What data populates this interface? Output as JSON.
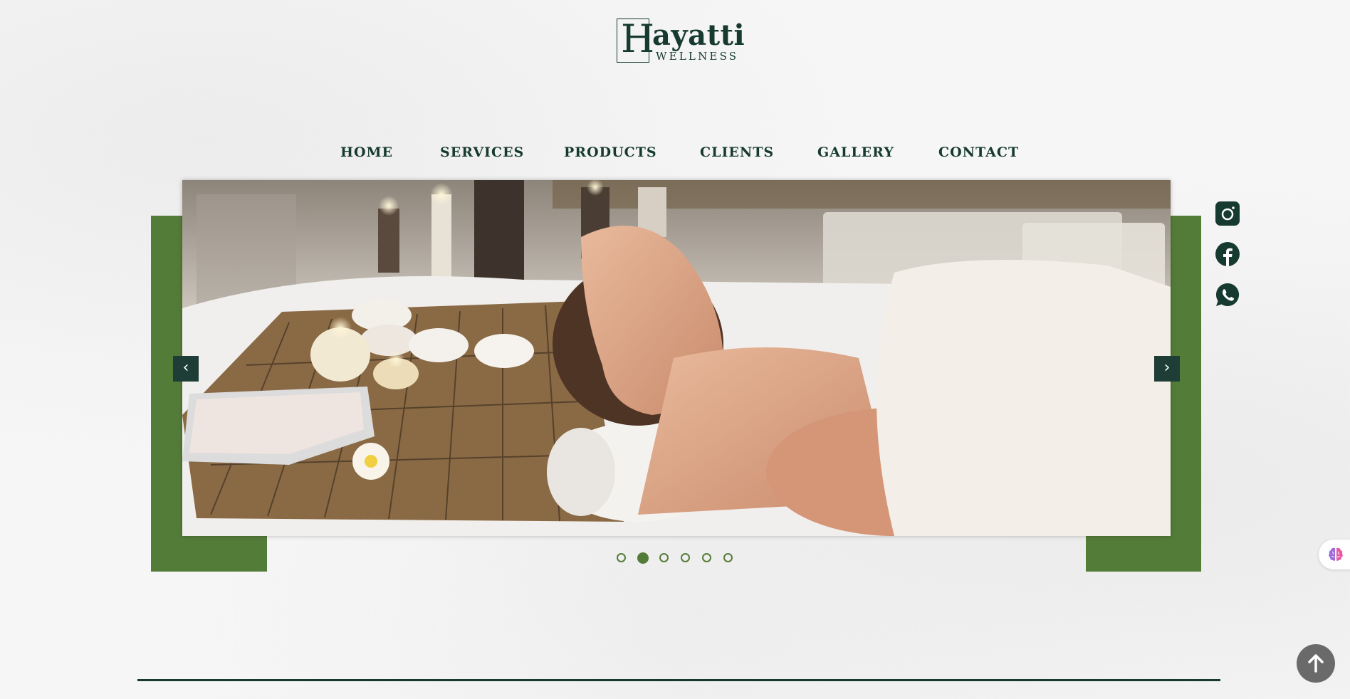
{
  "logo": {
    "letter": "H",
    "word": "ayatti",
    "subtitle": "WELLNESS"
  },
  "nav": {
    "items": [
      {
        "label": "HOME"
      },
      {
        "label": "SERVICES"
      },
      {
        "label": "PRODUCTS"
      },
      {
        "label": "CLIENTS"
      },
      {
        "label": "GALLERY"
      },
      {
        "label": "CONTACT"
      }
    ]
  },
  "slider": {
    "prev_label": "‹",
    "next_label": "›",
    "slide_count": 6,
    "active_index": 1,
    "image_subject": "woman relaxing on spa massage table with candles, stones, salt and towel"
  },
  "social": {
    "icons": [
      "instagram-icon",
      "facebook-icon",
      "whatsapp-icon"
    ]
  },
  "colors": {
    "brand_dark": "#163a30",
    "brand_green": "#547c39",
    "arrow_bg": "#1e3d36"
  }
}
